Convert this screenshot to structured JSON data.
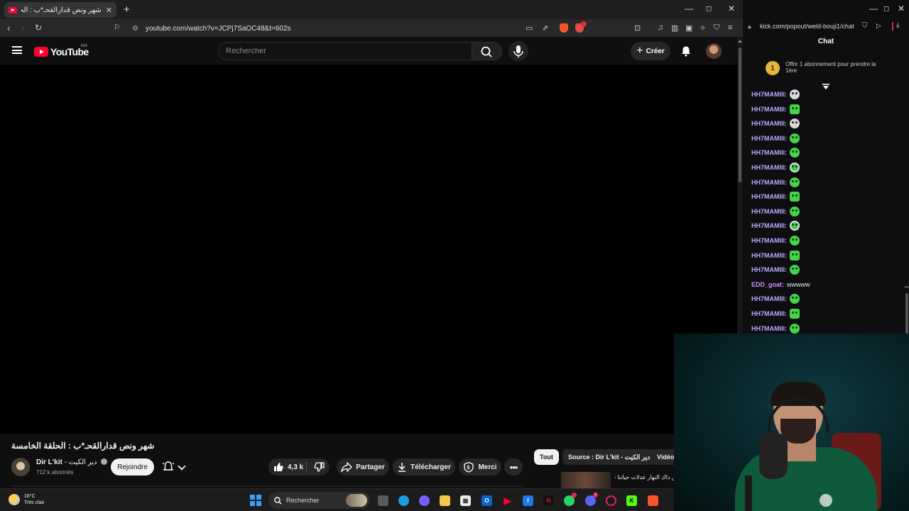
{
  "browser": {
    "tab_title": "شهر ونص قدارالقحـ*ب : الحلقة الخا",
    "url": "youtube.com/watch?v=JCPj7SaOC48&t=602s"
  },
  "youtube": {
    "logo_text": "YouTube",
    "country_code": "MA",
    "search_placeholder": "Rechercher",
    "create_label": "Créer"
  },
  "video": {
    "title": "شهر ونص قدارالقحـ*ب : الحلقة الخامسة",
    "channel_name": "Dir L'kit",
    "channel_arabic": "- دير الكيت",
    "subscribers": "712 k abonnés",
    "join_label": "Rejoindre",
    "likes": "4,3 k",
    "share_label": "Partager",
    "download_label": "Télécharger",
    "thanks_label": "Merci"
  },
  "recommendations": {
    "chips": [
      "Tout",
      "Source : Dir L'kit - دير الكيت",
      "Vidéo"
    ],
    "first_title": "من داك النهار عدلات حياتنا فيديو قصة الحلقة ..."
  },
  "chat_window": {
    "url": "kick.com/popout/weld-bouji1/chat",
    "title": "Chat",
    "offer_text": "Offrir 1 abonnement pour prendre la 1ère",
    "offer_count": "1",
    "messages": [
      {
        "user": "HH7MAMIII:",
        "emote": "face",
        "color": "#b9a8ff"
      },
      {
        "user": "HH7MAMIII:",
        "emote": "box",
        "color": "#b9a8ff"
      },
      {
        "user": "HH7MAMIII:",
        "emote": "face",
        "color": "#b9a8ff"
      },
      {
        "user": "HH7MAMIII:",
        "emote": "smile",
        "color": "#b9a8ff"
      },
      {
        "user": "HH7MAMIII:",
        "emote": "smile",
        "color": "#b9a8ff"
      },
      {
        "user": "HH7MAMIII:",
        "emote": "alien",
        "color": "#b9a8ff"
      },
      {
        "user": "HH7MAMIII:",
        "emote": "smile",
        "color": "#b9a8ff"
      },
      {
        "user": "HH7MAMIII:",
        "emote": "box",
        "color": "#b9a8ff"
      },
      {
        "user": "HH7MAMIII:",
        "emote": "smile",
        "color": "#b9a8ff"
      },
      {
        "user": "HH7MAMIII:",
        "emote": "alien",
        "color": "#b9a8ff"
      },
      {
        "user": "HH7MAMIII:",
        "emote": "smile",
        "color": "#b9a8ff"
      },
      {
        "user": "HH7MAMIII:",
        "emote": "box",
        "color": "#b9a8ff"
      },
      {
        "user": "HH7MAMIII:",
        "emote": "smile",
        "color": "#b9a8ff"
      },
      {
        "user": "EDD_goat:",
        "text": "wwwww",
        "color": "#d38cff"
      },
      {
        "user": "HH7MAMIII:",
        "emote": "smile",
        "color": "#b9a8ff"
      },
      {
        "user": "HH7MAMIII:",
        "emote": "box",
        "color": "#b9a8ff"
      },
      {
        "user": "HH7MAMIII:",
        "emote": "smile",
        "color": "#b9a8ff"
      }
    ]
  },
  "taskbar": {
    "temperature": "18°C",
    "weather": "Très clair",
    "search_label": "Rechercher",
    "notification_count": "1"
  }
}
